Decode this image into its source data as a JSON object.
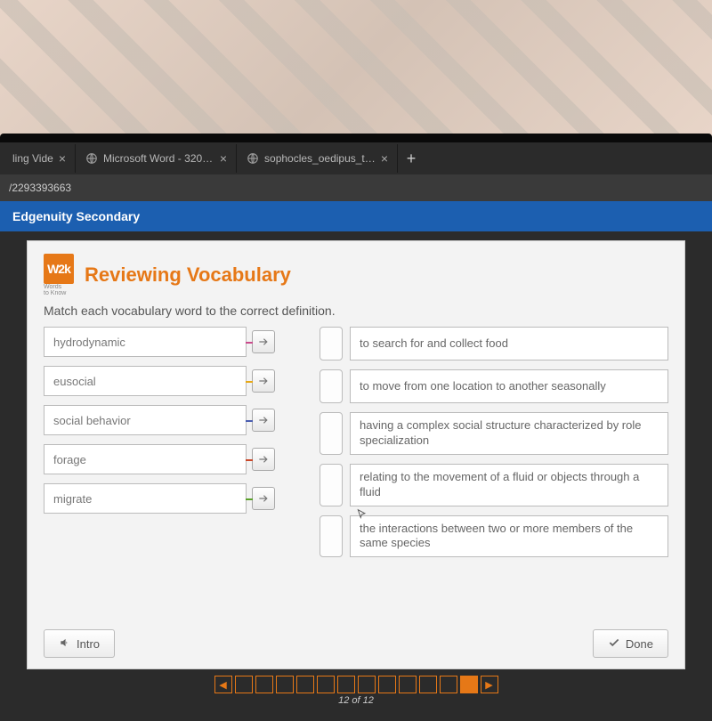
{
  "browser": {
    "tabs": [
      {
        "title": "ling Vide",
        "has_favicon": false
      },
      {
        "title": "Microsoft Word - 3209-06-04-st",
        "has_favicon": true
      },
      {
        "title": "sophocles_oedipus_the_king_tra",
        "has_favicon": true
      }
    ],
    "url_fragment": "/2293393663"
  },
  "site": {
    "header_title": "Edgenuity Secondary"
  },
  "panel": {
    "logo_text": "W2k",
    "logo_subline1": "Words",
    "logo_subline2": "to Know",
    "title": "Reviewing Vocabulary",
    "instruction": "Match each vocabulary word to the correct definition."
  },
  "words": [
    "hydrodynamic",
    "eusocial",
    "social behavior",
    "forage",
    "migrate"
  ],
  "definitions": [
    "to search for and collect food",
    "to move from one location to another seasonally",
    "having a complex social structure characterized by role specialization",
    "relating to the movement of a fluid or objects through a fluid",
    "the interactions between two or more members of the same species"
  ],
  "footer": {
    "intro_label": "Intro",
    "done_label": "Done"
  },
  "pager": {
    "total": 12,
    "current": 12,
    "label": "12 of 12"
  },
  "colors": {
    "accent": "#e67817",
    "header_blue": "#1c5fb0"
  }
}
